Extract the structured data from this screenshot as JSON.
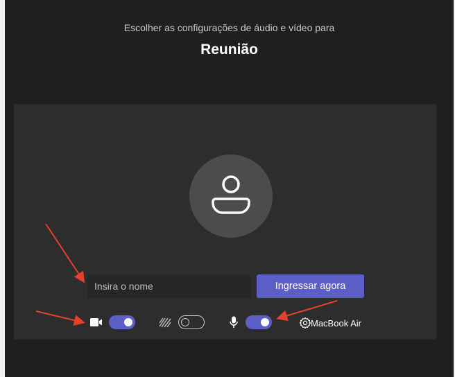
{
  "header": {
    "subtitle": "Escolher as configurações de áudio e vídeo para",
    "title": "Reunião"
  },
  "avatar": {
    "icon": "person-icon"
  },
  "name_input": {
    "placeholder": "Insira o nome",
    "value": ""
  },
  "join_button": {
    "label": "Ingressar agora"
  },
  "controls": {
    "camera": {
      "icon": "camera-icon",
      "enabled": true
    },
    "background_effects": {
      "icon": "background-blur-icon",
      "enabled": false
    },
    "microphone": {
      "icon": "microphone-icon",
      "enabled": true
    },
    "device_settings": {
      "icon": "gear-icon",
      "device_label": "MacBook Air"
    }
  },
  "annotations": {
    "arrow_color": "#e5412d"
  },
  "colors": {
    "accent": "#5b5fc7",
    "background": "#1f1f1f",
    "panel": "#2d2d2d"
  }
}
